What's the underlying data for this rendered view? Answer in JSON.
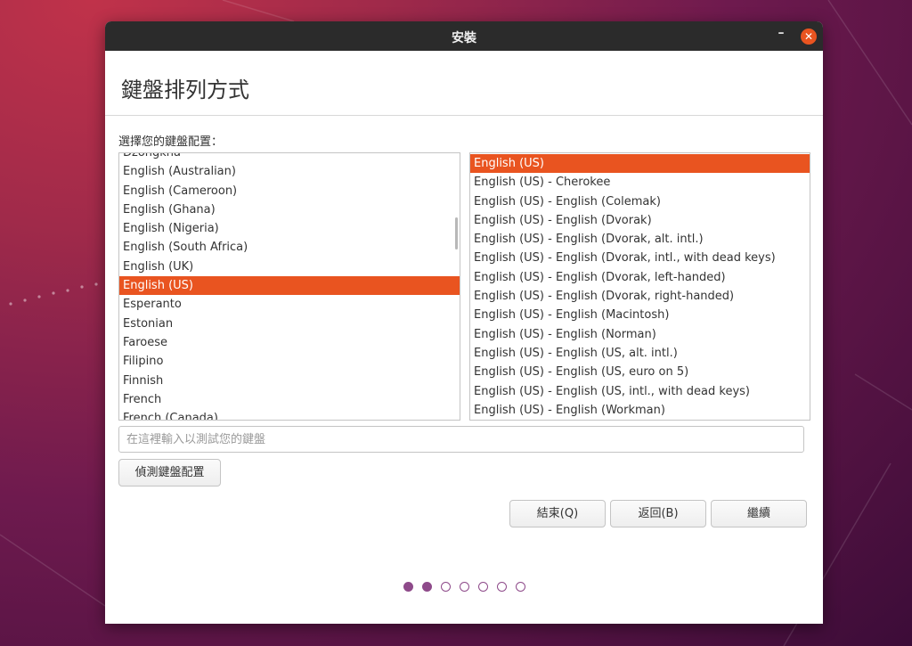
{
  "window": {
    "title": "安裝"
  },
  "page": {
    "title": "鍵盤排列方式",
    "prompt": "選擇您的鍵盤配置："
  },
  "layouts": [
    "Dzongkha",
    "English (Australian)",
    "English (Cameroon)",
    "English (Ghana)",
    "English (Nigeria)",
    "English (South Africa)",
    "English (UK)",
    "English (US)",
    "Esperanto",
    "Estonian",
    "Faroese",
    "Filipino",
    "Finnish",
    "French",
    "French (Canada)"
  ],
  "layouts_selected": "English (US)",
  "variants": [
    "English (US)",
    "English (US) - Cherokee",
    "English (US) - English (Colemak)",
    "English (US) - English (Dvorak)",
    "English (US) - English (Dvorak, alt. intl.)",
    "English (US) - English (Dvorak, intl., with dead keys)",
    "English (US) - English (Dvorak, left-handed)",
    "English (US) - English (Dvorak, right-handed)",
    "English (US) - English (Macintosh)",
    "English (US) - English (Norman)",
    "English (US) - English (US, alt. intl.)",
    "English (US) - English (US, euro on 5)",
    "English (US) - English (US, intl., with dead keys)",
    "English (US) - English (Workman)"
  ],
  "variants_selected": "English (US)",
  "test_input": {
    "placeholder": "在這裡輸入以測試您的鍵盤",
    "value": ""
  },
  "buttons": {
    "detect": "偵測鍵盤配置",
    "quit": "結束(Q)",
    "back": "返回(B)",
    "continue": "繼續"
  },
  "progress": {
    "current_step": 2,
    "total_steps": 7
  },
  "colors": {
    "accent": "#e95420",
    "progress_dot": "#8e4a8a",
    "titlebar": "#2b2b2b"
  }
}
